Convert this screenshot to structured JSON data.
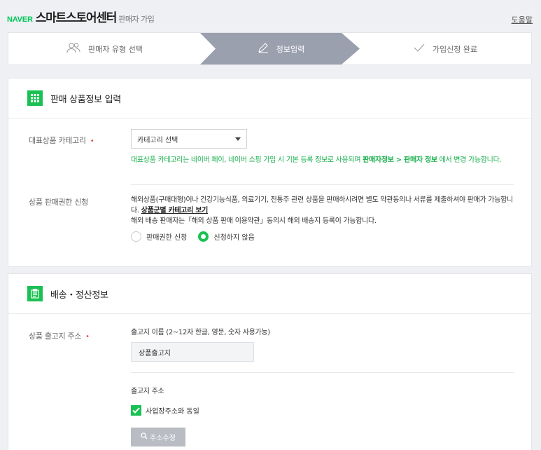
{
  "header": {
    "logo_naver": "NAVER",
    "brand": "스마트스토어센터",
    "subtitle": "판매자 가입",
    "help": "도움말"
  },
  "steps": [
    {
      "label": "판매자 유형 선택",
      "icon": "users-icon",
      "state": "done"
    },
    {
      "label": "정보입력",
      "icon": "pencil-icon",
      "state": "active"
    },
    {
      "label": "가입신청 완료",
      "icon": "check-icon",
      "state": "pending"
    }
  ],
  "product_section": {
    "title": "판매 상품정보 입력",
    "icon": "grid-icon",
    "category": {
      "label": "대표상품 카테고리",
      "required_mark": "•",
      "select_value": "카테고리 선택",
      "note_pre": "대표상품 카테고리는 네이버 페이, 네이버 쇼핑 가입 시 기본 등록 정보로 사용되며 ",
      "note_bold": "판매자정보 > 판매자 정보",
      "note_post": " 에서 변경 가능합니다."
    },
    "permission": {
      "label": "상품 판매권한 신청",
      "text1": "해외상품(구매대행)이나 건강기능식품, 의료기기, 전통주 관련 상품을 판매하시려면 별도 약관동의나 서류를 제출하셔야 판매가 가능합니다. ",
      "link": "상품군별 카테고리 보기",
      "text2": "해외 배송 판매자는「해외 상품 판매 이용약관」동의시 해외 배송지 등록이 가능합니다.",
      "options": [
        {
          "label": "판매권한 신청",
          "selected": false
        },
        {
          "label": "신청하지 않음",
          "selected": true
        }
      ]
    }
  },
  "shipping_section": {
    "title": "배송・정산정보",
    "icon": "clipboard-icon",
    "address": {
      "label": "상품 출고지 주소",
      "required_mark": "•",
      "name_label": "출고지 이름 (2~12자 한글, 영문, 숫자 사용가능)",
      "name_value": "상품출고지",
      "addr_label": "출고지 주소",
      "same_checkbox": "사업장주소와 동일",
      "same_checked": true,
      "edit_button": "주소수정"
    }
  },
  "colors": {
    "accent": "#19c153",
    "active_step": "#9aa0ae",
    "required": "#e44848",
    "note": "#19b04d"
  }
}
